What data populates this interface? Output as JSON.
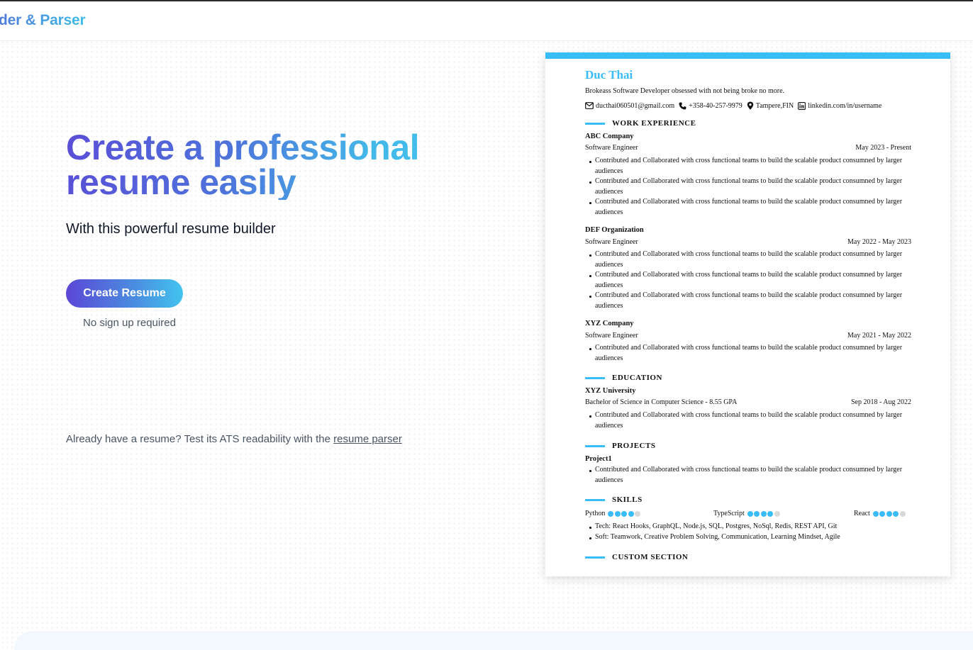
{
  "header": {
    "logo_text": "der & Parser"
  },
  "hero": {
    "title": "Create a professional resume easily",
    "subtitle": "With this powerful resume builder",
    "cta_label": "Create Resume",
    "cta_note": "No sign up required",
    "parser_prefix": "Already have a resume? Test its ATS readability with the ",
    "parser_link": "resume parser"
  },
  "resume": {
    "accent_color": "#38bdf8",
    "name": "Duc Thai",
    "summary": "Brokeass Software Developer obsessed with not being broke no more.",
    "contacts": [
      {
        "icon": "mail-icon",
        "text": "ducthai060501@gmail.com"
      },
      {
        "icon": "phone-icon",
        "text": "+358-40-257-9979"
      },
      {
        "icon": "location-icon",
        "text": "Tampere,FIN"
      },
      {
        "icon": "linkedin-icon",
        "text": "linkedin.com/in/username"
      }
    ],
    "sections": {
      "work": "WORK EXPERIENCE",
      "education": "EDUCATION",
      "projects": "PROJECTS",
      "skills": "SKILLS",
      "custom": "CUSTOM SECTION"
    },
    "work": [
      {
        "company": "ABC Company",
        "title": "Software Engineer",
        "date": "May 2023 - Present",
        "bullets": [
          "Contributed and Collaborated with cross functional teams to build the scalable product consumned by larger audiences",
          "Contributed and Collaborated with cross functional teams to build the scalable product consumned by larger audiences",
          "Contributed and Collaborated with cross functional teams to build the scalable product consumned by larger audiences"
        ]
      },
      {
        "company": "DEF Organization",
        "title": "Software Engineer",
        "date": "May 2022 - May 2023",
        "bullets": [
          "Contributed and Collaborated with cross functional teams to build the scalable product consumned by larger audiences",
          "Contributed and Collaborated with cross functional teams to build the scalable product consumned by larger audiences",
          "Contributed and Collaborated with cross functional teams to build the scalable product consumned by larger audiences"
        ]
      },
      {
        "company": "XYZ Company",
        "title": "Software Engineer",
        "date": "May 2021 - May 2022",
        "bullets": [
          "Contributed and Collaborated with cross functional teams to build the scalable product consumned by larger audiences"
        ]
      }
    ],
    "education": {
      "school": "XYZ University",
      "degree": "Bachelor of Science in Computer Science - 8.55 GPA",
      "date": "Sep 2018 - Aug 2022",
      "bullets": [
        "Contributed and Collaborated with cross functional teams to build the scalable product consumned by larger audiences"
      ]
    },
    "projects": {
      "name": "Project1",
      "bullets": [
        "Contributed and Collaborated with cross functional teams to build the scalable product consumned by larger audiences"
      ]
    },
    "skills": {
      "rated": [
        {
          "name": "Python",
          "level": 4,
          "max": 5
        },
        {
          "name": "TypeScript",
          "level": 4,
          "max": 5
        },
        {
          "name": "React",
          "level": 4,
          "max": 5
        }
      ],
      "lists": [
        "Tech: React Hooks, GraphQL, Node.js, SQL, Postgres, NoSql, Redis, REST API, Git",
        "Soft: Teamwork, Creative Problem Solving, Communication, Learning Mindset, Agile"
      ]
    }
  }
}
